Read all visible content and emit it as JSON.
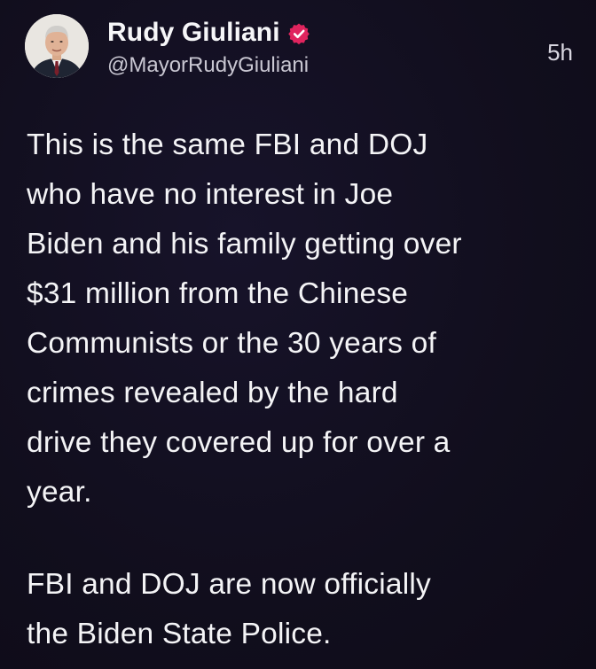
{
  "post": {
    "author": {
      "display_name": "Rudy Giuliani",
      "handle": "@MayorRudyGiuliani",
      "verified_icon": "verified-badge-icon",
      "avatar": "profile-photo"
    },
    "timestamp": "5h",
    "paragraphs": [
      "This is the same FBI and DOJ\nwho have no interest in Joe\nBiden and his family getting over\n$31 million from the Chinese\nCommunists or the 30 years of\ncrimes revealed by the hard\ndrive they covered up for over a\nyear.",
      "FBI and DOJ are now officially\nthe Biden State Police."
    ]
  },
  "colors": {
    "background": "#120f1f",
    "text": "#f4f4f6",
    "secondary_text": "#c9c7d2",
    "verified_badge": "#e0245e"
  }
}
